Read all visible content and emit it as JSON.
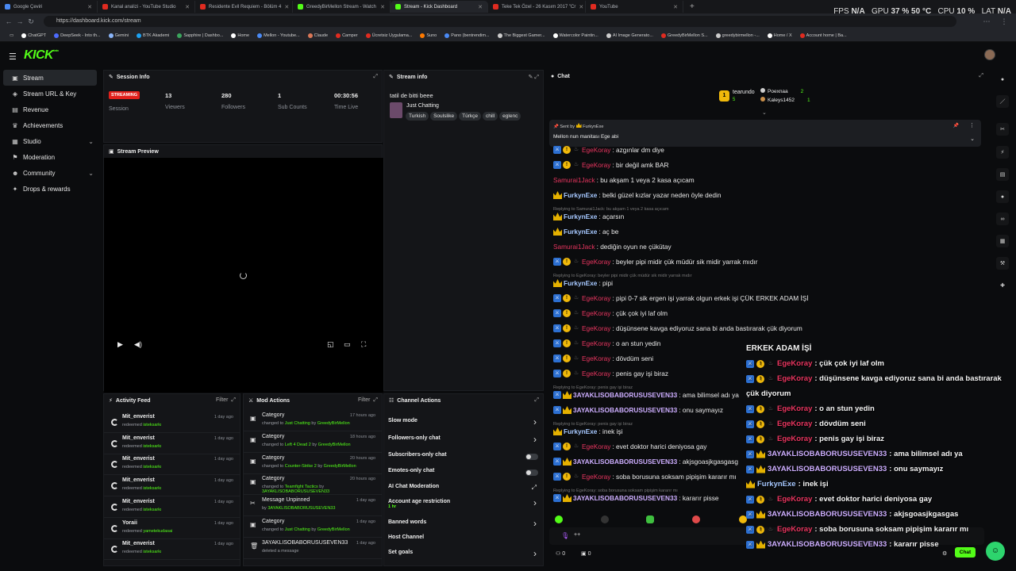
{
  "browser": {
    "tabs": [
      {
        "label": "Google Çeviri",
        "color": "#4a8af4"
      },
      {
        "label": "Kanal analizi - YouTube Studio",
        "color": "#e02b20"
      },
      {
        "label": "Residente Evil Requiem - Bölüm 4",
        "color": "#e02b20"
      },
      {
        "label": "GreedyBirMellon Stream - Watch",
        "color": "#53fc18"
      },
      {
        "label": "Stream - Kick Dashboard",
        "color": "#53fc18"
      },
      {
        "label": "Teke Tek Özel - 26 Kasım 2017 \"Cr",
        "color": "#e02b20"
      },
      {
        "label": "YouTube",
        "color": "#e02b20"
      }
    ],
    "perf": {
      "fps_label": "FPS",
      "fps": "N/A",
      "gpu_label": "GPU",
      "gpu": "37 % 50 °C",
      "cpu_label": "CPU",
      "cpu": "10 %",
      "lat_label": "LAT",
      "lat": "N/A"
    },
    "url": "https://dashboard.kick.com/stream",
    "bookmarks": [
      {
        "label": "ChatGPT",
        "color": "#ffffff"
      },
      {
        "label": "DeepSeek - Into th...",
        "color": "#4d6bfe"
      },
      {
        "label": "Gemini",
        "color": "#8ab4f8"
      },
      {
        "label": "BTK Akademi",
        "color": "#1da1f2"
      },
      {
        "label": "Sapphire | Dashbo...",
        "color": "#3ba55d"
      },
      {
        "label": "Home",
        "color": "#ffffff"
      },
      {
        "label": "Mellon - Youtube...",
        "color": "#4a8af4"
      },
      {
        "label": "Claude",
        "color": "#d97757"
      },
      {
        "label": "Camper",
        "color": "#e02b20"
      },
      {
        "label": "Ücretsiz Uygulama...",
        "color": "#e02b20"
      },
      {
        "label": "Suno",
        "color": "#ff7a00"
      },
      {
        "label": "Pano (bentrendim...",
        "color": "#4a8af4"
      },
      {
        "label": "The Biggest Gamer...",
        "color": "#cccccc"
      },
      {
        "label": "Watercolor Paintin...",
        "color": "#ffffff"
      },
      {
        "label": "AI Image Generato...",
        "color": "#cccccc"
      },
      {
        "label": "GreedyBirMellon S...",
        "color": "#e02b20"
      },
      {
        "label": "greedybirmellon -...",
        "color": "#cccccc"
      },
      {
        "label": "Home / X",
        "color": "#ffffff"
      },
      {
        "label": "Account home | Ba...",
        "color": "#e02b20"
      }
    ]
  },
  "kick": {
    "logo": "KICK",
    "logo_sup": "beta"
  },
  "sidebar": [
    {
      "label": "Stream",
      "icon": "stream-icon",
      "glyph": "▣",
      "active": true,
      "chev": ""
    },
    {
      "label": "Stream URL & Key",
      "icon": "key-icon",
      "glyph": "◈",
      "active": false,
      "chev": ""
    },
    {
      "label": "Revenue",
      "icon": "revenue-icon",
      "glyph": "▤",
      "active": false,
      "chev": ""
    },
    {
      "label": "Achievements",
      "icon": "trophy-icon",
      "glyph": "♛",
      "active": false,
      "chev": ""
    },
    {
      "label": "Studio",
      "icon": "studio-icon",
      "glyph": "▦",
      "active": false,
      "chev": "⌄"
    },
    {
      "label": "Moderation",
      "icon": "moderation-icon",
      "glyph": "⚑",
      "active": false,
      "chev": ""
    },
    {
      "label": "Community",
      "icon": "community-icon",
      "glyph": "☻",
      "active": false,
      "chev": "⌄"
    },
    {
      "label": "Drops & rewards",
      "icon": "gift-icon",
      "glyph": "✦",
      "active": false,
      "chev": ""
    }
  ],
  "session": {
    "title": "Session Info",
    "badge": "STREAMING",
    "session_label": "Session",
    "viewers": "13",
    "viewers_label": "Viewers",
    "followers": "280",
    "followers_label": "Followers",
    "subs": "1",
    "subs_label": "Sub Counts",
    "time": "00:30:56",
    "time_label": "Time Live"
  },
  "stream_info": {
    "title": "Stream info",
    "stream_title": "tatil de bitti beee",
    "category": "Just Chatting",
    "tags": [
      "Turkish",
      "Soulslike",
      "Türkçe",
      "chill",
      "eglenc"
    ]
  },
  "preview": {
    "title": "Stream Preview"
  },
  "chat": {
    "title": "Chat",
    "top_user": "tearundo",
    "top_count": "5",
    "top2": [
      {
        "name": "Poexnaa",
        "count": "2"
      },
      {
        "name": "Kaleys1452",
        "count": "1"
      }
    ],
    "pinned_by_label": "Sent by",
    "pinned_by": "FurkynExe",
    "pinned_text": "Mellon nun manitası Ege abi",
    "messages": [
      {
        "user": "EgeKoray",
        "text": ": azgınlar dm diye",
        "type": "badged"
      },
      {
        "user": "EgeKoray",
        "text": ": bir değil amk BAR",
        "type": "badged"
      },
      {
        "user": "Samurai1Jack",
        "text": ": bu akşam 1 veya 2 kasa açıcam",
        "type": "plain"
      },
      {
        "user": "FurkynExe",
        "text": ": belki güzel kızlar yazar neden öyle dedin",
        "type": "crown"
      },
      {
        "user": "FurkynExe",
        "text": ": açarsın",
        "type": "crown",
        "reply": "Replying to Samurai1Jack: bu akşam 1 veya 2 kasa açıcam"
      },
      {
        "user": "FurkynExe",
        "text": ": aç be",
        "type": "crown"
      },
      {
        "user": "Samurai1Jack",
        "text": ": dediğin oyun ne çükütay",
        "type": "plain"
      },
      {
        "user": "EgeKoray",
        "text": ": beyler pipi midir çük müdür sik midir yarrak mıdır",
        "type": "badged"
      },
      {
        "user": "FurkynExe",
        "text": ": pipi",
        "type": "crown",
        "reply": "Replying to EgeKoray: beyler pipi midir çük müdür sik midir yarrak mıdır"
      },
      {
        "user": "EgeKoray",
        "text": ": pipi 0-7 sik ergen işi yarrak olgun erkek işi ÇÜK ERKEK ADAM İŞİ",
        "type": "badged"
      },
      {
        "user": "EgeKoray",
        "text": ": çük çok iyi laf olm",
        "type": "badged"
      },
      {
        "user": "EgeKoray",
        "text": ": düşünsene kavga ediyoruz sana bi anda bastırarak çük diyorum",
        "type": "badged"
      },
      {
        "user": "EgeKoray",
        "text": ": o an stun yedin",
        "type": "badged"
      },
      {
        "user": "EgeKoray",
        "text": ": dövdüm seni",
        "type": "badged"
      },
      {
        "user": "EgeKoray",
        "text": ": penis gay işi biraz",
        "type": "badged"
      },
      {
        "user": "3AYAKLISOBABORUSUSEVEN33",
        "text": ": ama bilimsel adı ya",
        "type": "crown2",
        "reply": "Replying to EgeKoray: penis gay işi biraz"
      },
      {
        "user": "3AYAKLISOBABORUSUSEVEN33",
        "text": ": onu saymayız",
        "type": "crown2"
      },
      {
        "user": "FurkynExe",
        "text": ": inek işi",
        "type": "crown",
        "reply": "Replying to EgeKoray: penis gay işi biraz"
      },
      {
        "user": "EgeKoray",
        "text": ": evet doktor harici deniyosa gay",
        "type": "badged"
      },
      {
        "user": "3AYAKLISOBABORUSUSEVEN33",
        "text": ": akjsgoasjkgasgasg",
        "type": "crown2"
      },
      {
        "user": "EgeKoray",
        "text": ": soba borusuna soksam pipişim kararır mı",
        "type": "badged"
      },
      {
        "user": "3AYAKLISOBABORUSUSEVEN33",
        "text": ": kararır pisse",
        "type": "crown2",
        "reply": "Replying to EgeKoray: soba borusuna soksam pipişim kararır mı"
      }
    ],
    "input_plus": "++",
    "footer_viewers": "0",
    "footer_count": "0",
    "chat_button": "Chat"
  },
  "overlay": {
    "header": "ERKEK ADAM İŞİ",
    "lines": [
      {
        "user": "EgeKoray",
        "text": ": çük çok iyi laf olm",
        "type": "badged"
      },
      {
        "user": "EgeKoray",
        "text": ": düşünsene kavga ediyoruz sana bi anda bastırarak",
        "type": "badged"
      },
      {
        "user": "",
        "text": "çük diyorum",
        "type": "cont"
      },
      {
        "user": "EgeKoray",
        "text": ": o an stun yedin",
        "type": "badged"
      },
      {
        "user": "EgeKoray",
        "text": ": dövdüm seni",
        "type": "badged"
      },
      {
        "user": "EgeKoray",
        "text": ": penis gay işi biraz",
        "type": "badged"
      },
      {
        "user": "3AYAKLISOBABORUSUSEVEN33",
        "text": ": ama bilimsel adı ya",
        "type": "crown2"
      },
      {
        "user": "3AYAKLISOBABORUSUSEVEN33",
        "text": ": onu saymayız",
        "type": "crown2"
      },
      {
        "user": "FurkynExe",
        "text": ": inek işi",
        "type": "crown"
      },
      {
        "user": "EgeKoray",
        "text": ": evet doktor harici deniyosa gay",
        "type": "badged"
      },
      {
        "user": "3AYAKLISOBABORUSUSEVEN33",
        "text": ": akjsgoasjkgasgas",
        "type": "crown2"
      },
      {
        "user": "EgeKoray",
        "text": ": soba borusuna soksam pipişim kararır mı",
        "type": "badged"
      },
      {
        "user": "3AYAKLISOBABORUSUSEVEN33",
        "text": ": kararır pisse",
        "type": "crown2"
      }
    ]
  },
  "activity": {
    "title": "Activity Feed",
    "filter": "Filter",
    "items": [
      {
        "name": "Mit_enverist",
        "pre": "redeemed",
        "reward": "isteksarkı",
        "time": "1 day ago"
      },
      {
        "name": "Mit_enverist",
        "pre": "redeemed",
        "reward": "isteksarkı",
        "time": "1 day ago"
      },
      {
        "name": "Mit_enverist",
        "pre": "redeemed",
        "reward": "isteksarkı",
        "time": "1 day ago"
      },
      {
        "name": "Mit_enverist",
        "pre": "redeemed",
        "reward": "isteksarkı",
        "time": "1 day ago"
      },
      {
        "name": "Mit_enverist",
        "pre": "redeemed",
        "reward": "isteksarkı",
        "time": "1 day ago"
      },
      {
        "name": "Yoraii",
        "pre": "redeemed",
        "reward": "yametekudasai",
        "time": "1 day ago"
      },
      {
        "name": "Mit_enverist",
        "pre": "redeemed",
        "reward": "isteksarkı",
        "time": "1 day ago"
      }
    ]
  },
  "mod": {
    "title": "Mod Actions",
    "filter": "Filter",
    "items": [
      {
        "title": "Category",
        "pre": "changed to",
        "target": "Just Chatting",
        "by": "by",
        "who": "GreedyBirMellon",
        "time": "17 hours ago"
      },
      {
        "title": "Category",
        "pre": "changed to",
        "target": "Left 4 Dead 2",
        "by": "by",
        "who": "GreedyBirMellon",
        "time": "18 hours ago"
      },
      {
        "title": "Category",
        "pre": "changed to",
        "target": "Counter-Strike 2",
        "by": "by",
        "who": "GreedyBirMellon",
        "time": "20 hours ago"
      },
      {
        "title": "Category",
        "pre": "changed to",
        "target": "Teamfight Tactics",
        "by": "by",
        "who": "3AYAKLISOBABORUSUSEVEN33",
        "time": "20 hours ago"
      },
      {
        "title": "Message Unpinned",
        "pre": "by",
        "target": "3AYAKLISOBABORUSUSEVEN33",
        "by": "",
        "who": "",
        "time": "1 day ago"
      },
      {
        "title": "Category",
        "pre": "changed to",
        "target": "Just Chatting",
        "by": "by",
        "who": "GreedyBirMellon",
        "time": "1 day ago"
      },
      {
        "title": "3AYAKLISOBABORUSUSEVEN33",
        "pre": "deleted a message",
        "target": "",
        "by": "",
        "who": "",
        "time": "1 day ago"
      }
    ]
  },
  "channel": {
    "title": "Channel Actions",
    "rows": [
      {
        "label": "Slow mode",
        "ctl": "chevron"
      },
      {
        "label": "Followers-only chat",
        "ctl": "chevron"
      },
      {
        "label": "Subscribers-only chat",
        "ctl": "toggle"
      },
      {
        "label": "Emotes-only chat",
        "ctl": "toggle"
      },
      {
        "label": "AI Chat Moderation",
        "ctl": "link"
      },
      {
        "label": "Account age restriction",
        "ctl": "chevron",
        "sub": "1 hr"
      },
      {
        "label": "Banned words",
        "ctl": "chevron"
      },
      {
        "label": "Host Channel",
        "ctl": "none"
      },
      {
        "label": "Set goals",
        "ctl": "chevron"
      }
    ]
  }
}
